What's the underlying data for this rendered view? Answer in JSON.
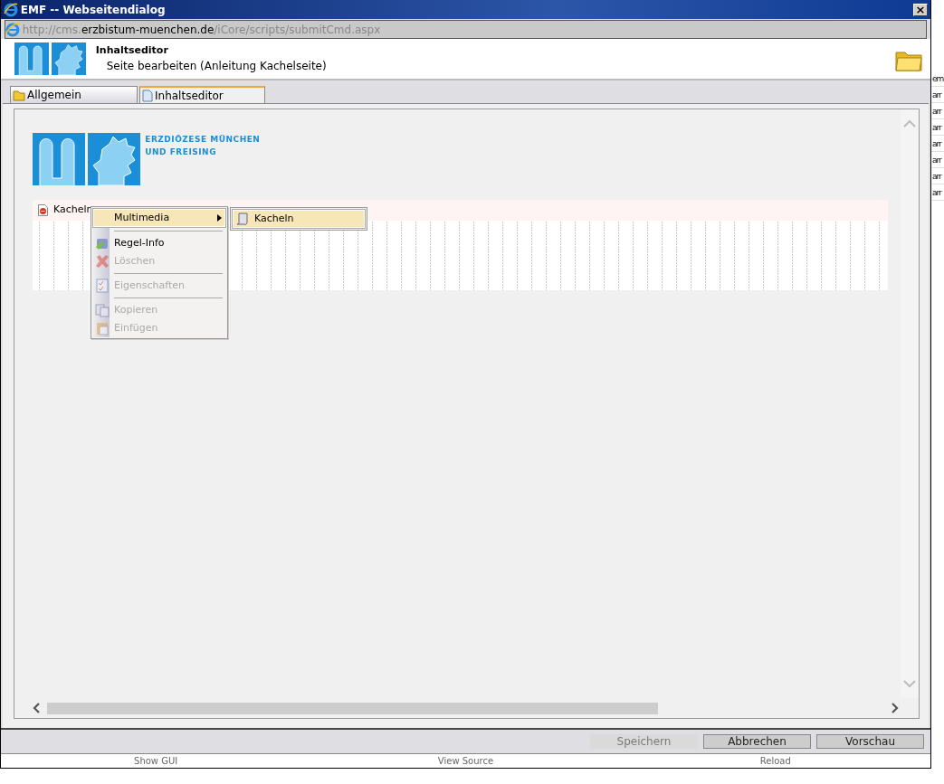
{
  "window": {
    "title": "EMF -- Webseitendialog",
    "close": "×"
  },
  "address": {
    "prefix": "http://cms.",
    "host": "erzbistum-muenchen.de",
    "path": "/iCore/scripts/submitCmd.aspx"
  },
  "header": {
    "title": "Inhaltseditor",
    "subtitle": "Seite bearbeiten (Anleitung Kachelseite)"
  },
  "tabs": [
    {
      "label": "Allgemein",
      "selected": false
    },
    {
      "label": "Inhaltseditor",
      "selected": true
    }
  ],
  "editor": {
    "brand_lines": [
      "ERZDIÖZESE MÜNCHEN",
      "UND FREISING"
    ],
    "rows": [
      {
        "label": "Kacheln",
        "selected": true
      }
    ]
  },
  "context_menu": {
    "items": [
      {
        "kind": "submenu",
        "label": "Multimedia",
        "selected": true,
        "disabled": false
      },
      {
        "kind": "separator"
      },
      {
        "kind": "item",
        "label": "Regel-Info",
        "selected": false,
        "disabled": false
      },
      {
        "kind": "item",
        "label": "Löschen",
        "selected": false,
        "disabled": true
      },
      {
        "kind": "separator"
      },
      {
        "kind": "item",
        "label": "Eigenschaften",
        "selected": false,
        "disabled": true
      },
      {
        "kind": "separator"
      },
      {
        "kind": "item",
        "label": "Kopieren",
        "selected": false,
        "disabled": true
      },
      {
        "kind": "item",
        "label": "Einfügen",
        "selected": false,
        "disabled": true
      }
    ],
    "submenu": [
      {
        "label": "Kacheln",
        "selected": true
      }
    ]
  },
  "buttons": [
    {
      "label": "Speichern",
      "disabled": true
    },
    {
      "label": "Abbrechen",
      "disabled": false
    },
    {
      "label": "Vorschau",
      "disabled": false
    }
  ],
  "footer_links": [
    "Show GUI",
    "View Source",
    "Reload"
  ],
  "background_window": {
    "fragments": [
      "em",
      "arr",
      "arr",
      "arr",
      "arr",
      "arr",
      "arr",
      "arr"
    ]
  }
}
